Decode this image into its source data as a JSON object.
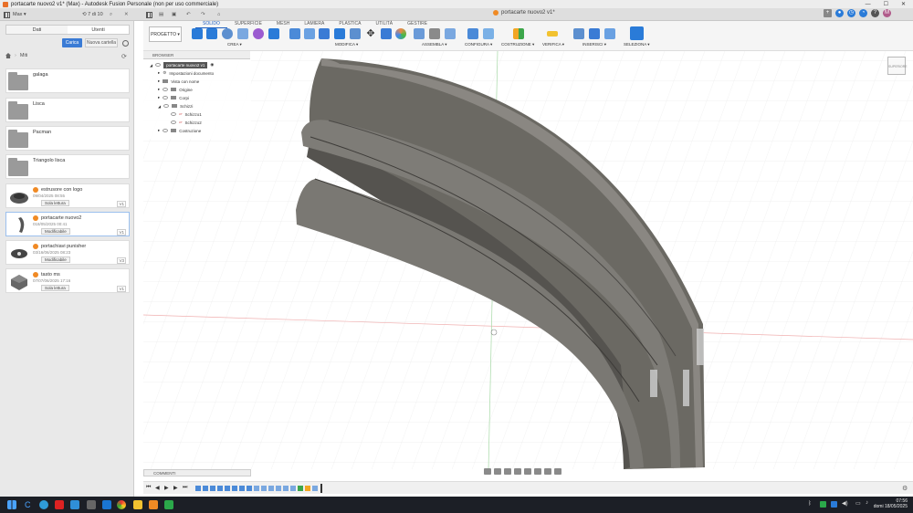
{
  "window": {
    "title": "portacarte nuovo2 v1* (Max) - Autodesk Fusion Personale (non per uso commerciale)",
    "controls": [
      "—",
      "☐",
      "✕"
    ]
  },
  "qat": {
    "user": "Max",
    "counter": "7 di 10",
    "doc_tab": "portacarte nuovo2 v1*"
  },
  "datapanel": {
    "tabs": [
      "Dati",
      "Utenti"
    ],
    "carica": "Carica",
    "nuova_cartella": "Nuova cartella",
    "breadcrumb": "Miti",
    "folders": [
      "galaga",
      "Lisca",
      "Pacman",
      "Triangolo lisca"
    ],
    "files": [
      {
        "name": "estrusore con logo",
        "date": "09/04/2025 08:55",
        "perm": "Sola lettura",
        "ver": "V1"
      },
      {
        "name": "portacarte nuovo2",
        "date": "018/05/2025 00:41",
        "perm": "Modificabile",
        "ver": "V1"
      },
      {
        "name": "portachiavi punisher",
        "date": "03/16/06/2025 08:23",
        "perm": "Modificabile",
        "ver": "V3"
      },
      {
        "name": "tasto ms",
        "date": "07/07/06/2025 17:16",
        "perm": "Sola lettura",
        "ver": "V1"
      }
    ]
  },
  "toolbar": {
    "progetto": "PROGETTO",
    "tabs": [
      "SOLIDO",
      "SUPERFICIE",
      "MESH",
      "LAMIERA",
      "PLASTICA",
      "UTILITÀ",
      "GESTIRE"
    ],
    "groups": [
      "CREA ▾",
      "MODIFICA ▾",
      "ASSEMBLA ▾",
      "CONFIGURA ▾",
      "COSTRUZIONE ▾",
      "VERIFICA ▾",
      "INSERISCI ▾",
      "SELEZIONA ▾"
    ]
  },
  "browser": {
    "title": "BROWSER",
    "root": "portacarte nuovo2 v1",
    "items": [
      "Impostazioni documento",
      "Vista con nome",
      "Origine",
      "Corpi",
      "Schizzi",
      "Schizzo1",
      "Schizzo2",
      "Costruzione"
    ]
  },
  "comments": "COMMENTI",
  "viewcube": "SUPERIORE",
  "taskbar": {
    "time": "07:56",
    "date": "domi 18/05/2025"
  },
  "colors": {
    "accent": "#2060c0",
    "brand": "#f08a24",
    "model": "#6b6963"
  }
}
